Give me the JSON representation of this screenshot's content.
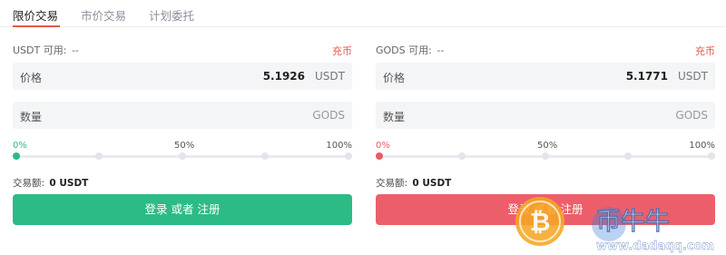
{
  "tabs": [
    {
      "label": "限价交易",
      "active": true
    },
    {
      "label": "市价交易",
      "active": false
    },
    {
      "label": "计划委托",
      "active": false
    }
  ],
  "buy": {
    "available_label": "USDT 可用:",
    "available_value": "--",
    "recharge": "充币",
    "price_label": "价格",
    "price_value": "5.1926",
    "price_unit": "USDT",
    "qty_label": "数量",
    "qty_unit": "GODS",
    "slider": {
      "pct_0": "0%",
      "pct_50": "50%",
      "pct_100": "100%",
      "value_fraction": 0
    },
    "amount_label": "交易额:",
    "amount_value": "0 USDT",
    "button": "登录 或者 注册",
    "accent": "#2dbb85"
  },
  "sell": {
    "available_label": "GODS 可用:",
    "available_value": "--",
    "recharge": "充币",
    "price_label": "价格",
    "price_value": "5.1771",
    "price_unit": "USDT",
    "qty_label": "数量",
    "qty_unit": "GODS",
    "slider": {
      "pct_0": "0%",
      "pct_50": "50%",
      "pct_100": "100%",
      "value_fraction": 0
    },
    "amount_label": "交易额:",
    "amount_value": "0 USDT",
    "button": "登录 或者 注册",
    "accent": "#ec5f6a"
  },
  "watermark": {
    "brand": "币牛牛",
    "url": "www.dadaqq.com"
  },
  "colors": {
    "tab_underline": "#e8584a",
    "recharge": "#e8584a",
    "field_bg": "#f4f5f7"
  }
}
